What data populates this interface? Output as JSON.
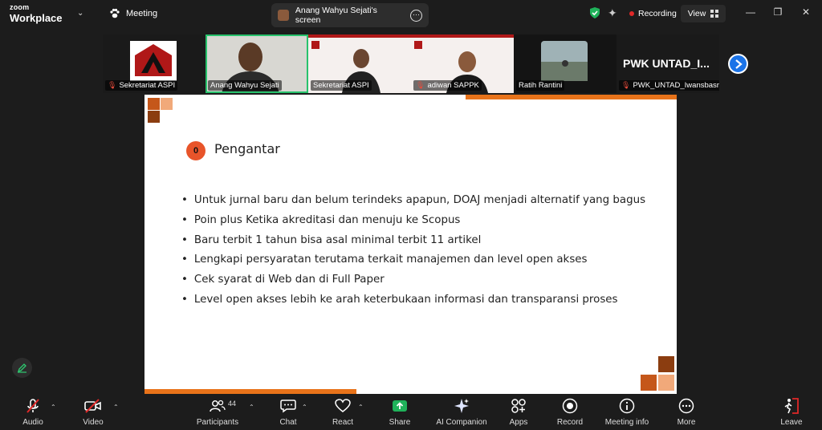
{
  "app": {
    "brand_top": "zoom",
    "brand_bottom": "Workplace"
  },
  "topbar": {
    "meeting_label": "Meeting",
    "share_tab_label": "Anang Wahyu Sejati's screen",
    "recording_label": "Recording",
    "view_label": "View"
  },
  "participants_strip": [
    {
      "name": "Sekretariat ASPI",
      "muted": true
    },
    {
      "name": "Anang Wahyu Sejati",
      "muted": false,
      "active_speaker": true
    },
    {
      "name": "Sekretariat ASPI",
      "muted": false
    },
    {
      "name": "adiwan SAPPK",
      "muted": true
    },
    {
      "name": "Ratih Rantini",
      "muted": false
    },
    {
      "name": "PWK_UNTAD_IwansbasriSC",
      "display": "PWK UNTAD_I...",
      "muted": true
    }
  ],
  "slide": {
    "badge": "0",
    "title": "Pengantar",
    "bullets": [
      "Untuk jurnal baru dan belum terindeks apapun, DOAJ menjadi alternatif yang bagus",
      "Poin plus Ketika akreditasi dan menuju ke Scopus",
      "Baru terbit 1 tahun bisa asal minimal terbit 11 artikel",
      "Lengkapi persyaratan terutama terkait manajemen dan level open akses",
      "Cek syarat di Web dan di Full Paper",
      "Level open akses lebih ke arah keterbukaan informasi dan transparansi proses"
    ]
  },
  "toolbar": {
    "audio": "Audio",
    "video": "Video",
    "participants": "Participants",
    "participants_count": "44",
    "chat": "Chat",
    "react": "React",
    "share": "Share",
    "ai": "AI Companion",
    "apps": "Apps",
    "record": "Record",
    "info": "Meeting info",
    "more": "More",
    "leave": "Leave"
  },
  "colors": {
    "accent_orange": "#e8731a",
    "share_green": "#1fb25a",
    "leave_red": "#e02828"
  }
}
